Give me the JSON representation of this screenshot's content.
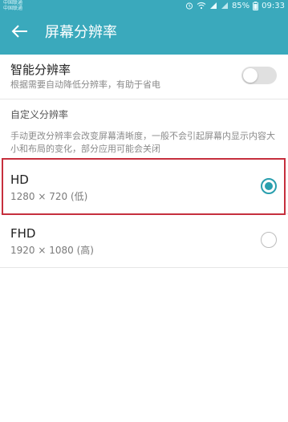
{
  "status_bar": {
    "carrier_1": "中国联通",
    "carrier_2": "中国联通",
    "battery": "85%",
    "time": "09:33"
  },
  "app_bar": {
    "title": "屏幕分辨率"
  },
  "smart_resolution": {
    "title": "智能分辨率",
    "description": "根据需要自动降低分辨率，有助于省电",
    "enabled": false
  },
  "custom_section": {
    "header": "自定义分辨率",
    "description": "手动更改分辨率会改变屏幕清晰度，一般不会引起屏幕内显示内容大小和布局的变化，部分应用可能会关闭"
  },
  "options": [
    {
      "title": "HD",
      "subtitle": "1280 × 720 (低)",
      "selected": true
    },
    {
      "title": "FHD",
      "subtitle": "1920 × 1080 (高)",
      "selected": false
    }
  ],
  "colors": {
    "app_bar": "#3aa9bc",
    "accent": "#2a9fae",
    "highlight": "#c62f3d"
  }
}
